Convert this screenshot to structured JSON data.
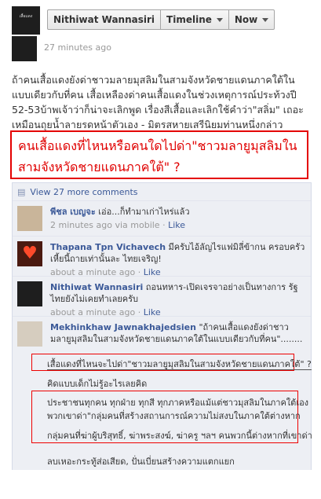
{
  "topbar": {
    "logo_text": "เสื้อแดง",
    "profile_name": "Nithiwat Wannasiri",
    "timeline_label": "Timeline",
    "now_label": "Now"
  },
  "post": {
    "time": "27 minutes ago",
    "status": "ถ้าคนเสื้อแดงยังด่าชาวมลายมุสลิมในสามจังหวัดชายแดนภาคใต้ในแบบเดียวกับที่คน เสื้อเหลืองด่าคนเสื้อแดงในช่วงเหตุการณ์ประท้วงปี 52-53บ้าพเจ้าว่าก็น่าจะเลิกพูด เรื่องสีเสื้อและเลิกใช้คำว่า\"สลิ่ม\" เถอะ เหมือนถุยน้ำลายรดหน้าตัวเอง - มิตรสหายเสรีนิยมท่านหนึ่งกล่าว",
    "highlight": "คนเสื้อแดงที่ไหนหรือคนใดไปด่า\"ชาวมลายูมุสลิมในสามจังหวัดชายแดนภาคใต้\" ?"
  },
  "comments": {
    "view_more": "View 27 more comments",
    "items": [
      {
        "name": "พีชล เบญจะ",
        "text": "เอ่อ...ก็ทำมาเก่าไหร่แล้ว",
        "time": "2 minutes ago via mobile",
        "like": "Like"
      },
      {
        "name": "Thapana Tpn Vichavech",
        "text": "มีครับไอ้ลัญไรแฟมิลี่ข้ากน ครอบครัวเหี้ยนี้ถายเท่านั้นละ ไทยเจริญ!",
        "time": "about a minute ago",
        "like": "Like"
      },
      {
        "name": "Nithiwat Wannasiri",
        "text": "ถอนทหาร-เปิดเจรจาอย่างเป็นทางการ รัฐไทยยังไม่เคยทำเลยครับ",
        "time": "about a minute ago",
        "like": "Like"
      },
      {
        "name": "Mekhinkhaw Jawnakhajedsien",
        "text": "\"ถ้าคนเสื้อแดงยังด่าชาวมลายูมุสลิมในสามจังหวัดชายแดนภาคใต้ในแบบเดียวกับที่คน\"........",
        "time": "",
        "like": ""
      }
    ]
  },
  "lines": {
    "l1": "เสื้อแดงที่ไหนจะไปด่า\"ชาวมลายูมุสลิมในสามจังหวัดชายแดนภาคใต้\" ?",
    "l2": "คิดแบบเด็กไม่รู้อะไรเลยคิด",
    "l3": "ประชาชนทุกคน ทุกฝ่าย ทุกสี ทุกภาคหรือแม้แต่ชาวมุสลิมในภาคใต้เอง",
    "l4": "พวกเขาด่า\"กลุ่มคนที่สร้างสถานการณ์ความไม่สงบในภาคใต้ต่างหาก",
    "l5": "กลุ่มคนที่ฆ่าผู้บริสุทธิ์, ฆ่าพระสงฆ์, ฆ่าครู ฯลฯ คนพวกนี้ต่างหากที่เขาด่า",
    "l6": "ลบเหอะกระทู้ส่อเสียด, ปั่นเบี่ยนสร้างความแตกแยก"
  }
}
